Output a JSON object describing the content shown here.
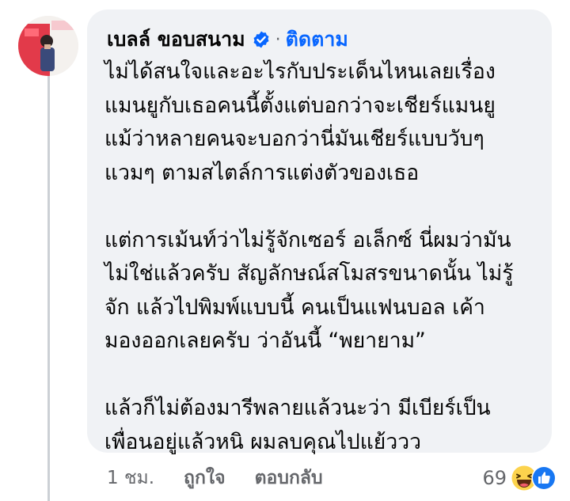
{
  "comment": {
    "author": "เบลล์ ขอบสนาม",
    "separator": "·",
    "follow_label": "ติดตาม",
    "paragraphs": [
      [
        "ไม่ได้สนใจและอะไรกับประเด็นไหนเลยเรื่อง",
        "แมนยูกับเธอคนนี้ตั้งแต่บอกว่าจะเชียร์แมนยู",
        "แม้ว่าหลายคนจะบอกว่านี่มันเชียร์แบบวับๆ",
        "แวมๆ ตามสไตล์การแต่งตัวของเธอ"
      ],
      [
        "แต่การเม้นท์ว่าไม่รู้จักเซอร์ อเล็กซ์ นี่ผมว่ามัน",
        "ไม่ใช่แล้วครับ สัญลักษณ์สโมสรขนาดนั้น ไม่รู้",
        "จัก แล้วไปพิมพ์แบบนี้ คนเป็นแฟนบอล เค้า",
        "มองออกเลยครับ ว่าอันนี้ “พยายาม”"
      ],
      [
        "แล้วก็ไม่ต้องมารีพลายแล้วนะว่า มีเบียร์เป็น",
        "เพื่อนอยู่แล้วหนิ ผมลบคุณไปแย้ววว"
      ]
    ]
  },
  "actions": {
    "time": "1 ชม.",
    "like_label": "ถูกใจ",
    "reply_label": "ตอบกลับ"
  },
  "reactions": {
    "count": "69",
    "icons": [
      "haha-icon",
      "like-icon"
    ]
  },
  "colors": {
    "bubble": "#f0f2f5",
    "link_blue": "#0866ff",
    "muted": "#65676b"
  }
}
